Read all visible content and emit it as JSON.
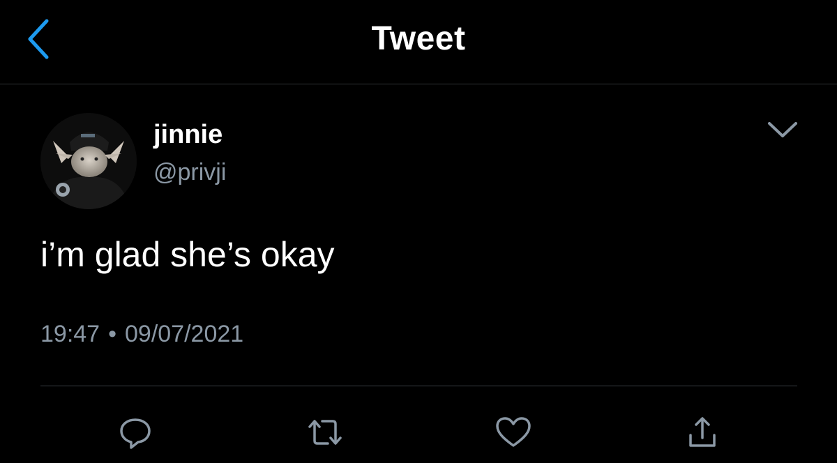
{
  "header": {
    "title": "Tweet",
    "back_icon": "chevron-left-icon",
    "accent_color": "#1d9bf0"
  },
  "tweet": {
    "author": {
      "display_name": "jinnie",
      "handle": "@privji"
    },
    "text": "i’m glad she’s okay",
    "time": "19:47",
    "separator": "•",
    "date": "09/07/2021",
    "menu_icon": "chevron-down-icon"
  },
  "actions": [
    {
      "icon": "reply-icon"
    },
    {
      "icon": "retweet-icon"
    },
    {
      "icon": "like-icon"
    },
    {
      "icon": "share-icon"
    }
  ],
  "colors": {
    "background": "#000000",
    "text_primary": "#ffffff",
    "text_secondary": "#8b98a5",
    "icon": "#8b98a5"
  }
}
